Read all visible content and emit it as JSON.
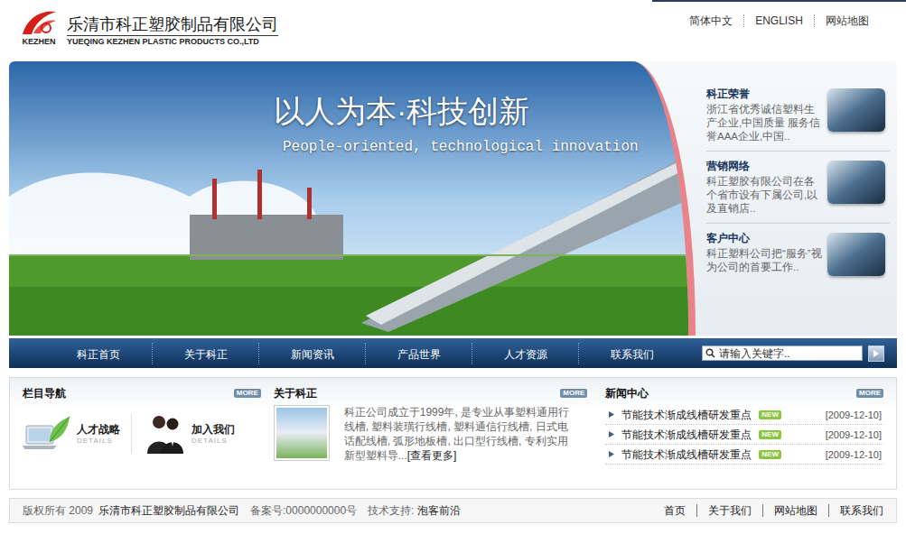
{
  "header": {
    "logo_text": "KEZHEN",
    "company_cn": "乐清市科正塑胶制品有限公司",
    "company_en": "YUEQING KEZHEN PLASTIC PRODUCTS CO.,LTD",
    "links": [
      "简体中文",
      "ENGLISH",
      "网站地图"
    ]
  },
  "banner": {
    "slogan_cn": "以人为本·科技创新",
    "slogan_en": "People-oriented, technological innovation",
    "features": [
      {
        "title": "科正荣誉",
        "desc": "浙江省优秀诚信塑料生产企业,中国质量 服务信誉AAA企业,中国.."
      },
      {
        "title": "营销网络",
        "desc": "科正塑胶有限公司在各个省市设有下属公司,以及直销店.."
      },
      {
        "title": "客户中心",
        "desc": "科正塑料公司把“服务”视为公司的首要工作.."
      }
    ]
  },
  "nav": {
    "items": [
      {
        "label": "科正首页",
        "selected": false
      },
      {
        "label": "关于科正",
        "selected": false
      },
      {
        "label": "新闻资讯",
        "selected": false
      },
      {
        "label": "产品世界",
        "selected": false
      },
      {
        "label": "人才资源",
        "selected": false
      },
      {
        "label": "联系我们",
        "selected": false
      }
    ],
    "search": {
      "placeholder": "请输入关键字.."
    }
  },
  "sidebar": {
    "title": "栏目导航",
    "more": "MORE",
    "items": [
      {
        "label": "人才战略",
        "sub": "DETAILS"
      },
      {
        "label": "加入我们",
        "sub": "DETAILS"
      }
    ]
  },
  "about": {
    "title": "关于科正",
    "more": "MORE",
    "text": "科正公司成立于1999年, 是专业从事塑料通用行线槽, 塑料装璜行线槽, 塑料通信行线槽, 日式电话配线槽, 弧形地板槽, 出口型行线槽, 专利实用新型塑料导...",
    "link": "[查看更多]"
  },
  "news": {
    "title": "新闻中心",
    "more": "MORE",
    "items": [
      {
        "title": "节能技术渐成线槽研发重点",
        "badge": "NEW",
        "date": "[2009-12-10]"
      },
      {
        "title": "节能技术渐成线槽研发重点",
        "badge": "NEW",
        "date": "[2009-12-10]"
      },
      {
        "title": "节能技术渐成线槽研发重点",
        "badge": "NEW",
        "date": "[2009-12-10]"
      }
    ]
  },
  "footer": {
    "copyright": "版权所有 2009",
    "company": "乐清市科正塑胶制品有限公司",
    "record": "备案号:0000000000号",
    "support_label": "技术支持:",
    "support": "泡客前沿",
    "links": [
      "首页",
      "关于我们",
      "网站地图",
      "联系我们"
    ]
  }
}
